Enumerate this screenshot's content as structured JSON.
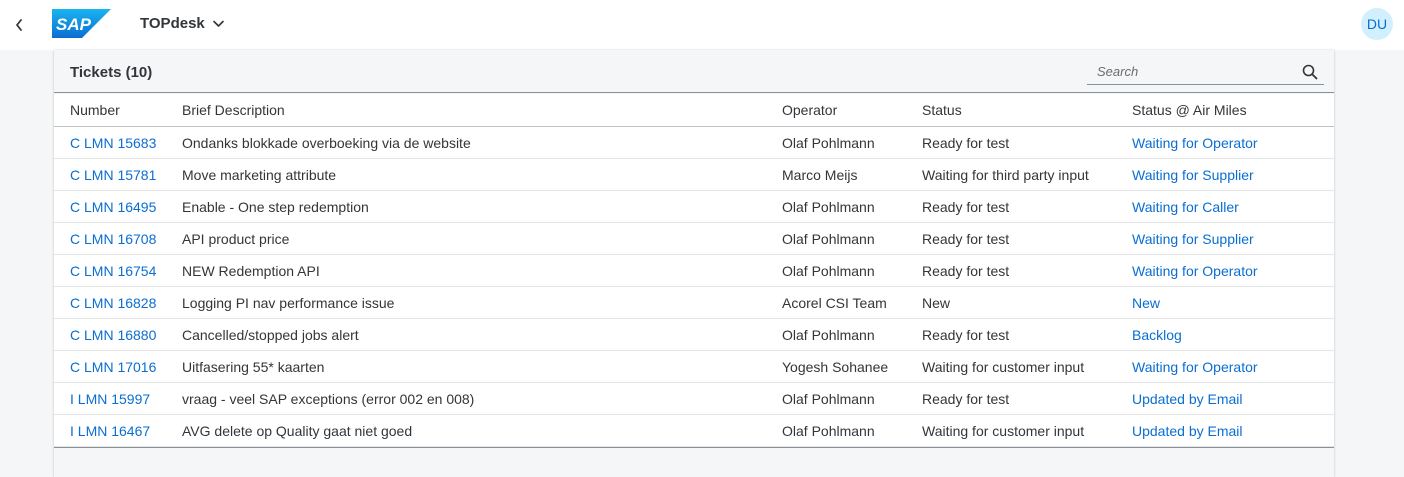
{
  "shell": {
    "app_title": "TOPdesk",
    "logo_text": "SAP",
    "user_initials": "DU",
    "brand_color": "#0a6ed1"
  },
  "table": {
    "title": "Tickets (10)",
    "search_placeholder": "Search",
    "columns": [
      "Number",
      "Brief Description",
      "Operator",
      "Status",
      "Status @ Air Miles"
    ],
    "rows": [
      {
        "number": "C LMN 15683",
        "description": "Ondanks blokkade overboeking via de website",
        "operator": "Olaf Pohlmann",
        "status": "Ready for test",
        "airmiles": "Waiting for Operator"
      },
      {
        "number": "C LMN 15781",
        "description": "Move marketing attribute",
        "operator": "Marco Meijs",
        "status": "Waiting for third party input",
        "airmiles": "Waiting for Supplier"
      },
      {
        "number": "C LMN 16495",
        "description": "Enable - One step redemption",
        "operator": "Olaf Pohlmann",
        "status": "Ready for test",
        "airmiles": "Waiting for Caller"
      },
      {
        "number": "C LMN 16708",
        "description": "API product price",
        "operator": "Olaf Pohlmann",
        "status": "Ready for test",
        "airmiles": "Waiting for Supplier"
      },
      {
        "number": "C LMN 16754",
        "description": "NEW Redemption API",
        "operator": "Olaf Pohlmann",
        "status": "Ready for test",
        "airmiles": "Waiting for Operator"
      },
      {
        "number": "C LMN 16828",
        "description": "Logging PI nav performance issue",
        "operator": "Acorel CSI Team",
        "status": "New",
        "airmiles": "New"
      },
      {
        "number": "C LMN 16880",
        "description": "Cancelled/stopped jobs alert",
        "operator": "Olaf Pohlmann",
        "status": "Ready for test",
        "airmiles": "Backlog"
      },
      {
        "number": "C LMN 17016",
        "description": "Uitfasering 55* kaarten",
        "operator": "Yogesh Sohanee",
        "status": "Waiting for customer input",
        "airmiles": "Waiting for Operator"
      },
      {
        "number": "I LMN 15997",
        "description": "vraag - veel SAP exceptions (error 002 en 008)",
        "operator": "Olaf Pohlmann",
        "status": "Ready for test",
        "airmiles": "Updated by Email"
      },
      {
        "number": "I LMN 16467",
        "description": "AVG delete op Quality gaat niet goed",
        "operator": "Olaf Pohlmann",
        "status": "Waiting for customer input",
        "airmiles": "Updated by Email"
      }
    ]
  }
}
